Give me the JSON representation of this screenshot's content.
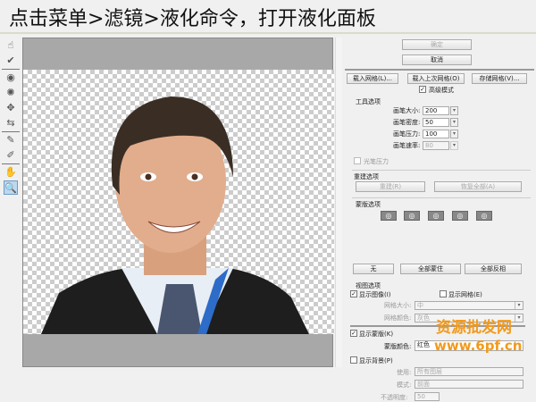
{
  "title": "点击菜单>滤镜>液化命令，打开液化面板",
  "tools": [
    "forward-warp",
    "reconstruct",
    "twirl",
    "pucker",
    "bloat",
    "push-left",
    "freeze-mask",
    "thaw-mask",
    "hand",
    "zoom"
  ],
  "panel": {
    "ok": "确定",
    "cancel": "取消",
    "load_mesh": "载入网格(L)...",
    "load_last_mesh": "载入上次网格(O)",
    "save_mesh": "存储网格(V)...",
    "advanced_mode": "高级模式",
    "advanced_checked": true,
    "tool_options": "工具选项",
    "brush_size_label": "画笔大小:",
    "brush_size": "200",
    "brush_density_label": "画笔密度:",
    "brush_density": "50",
    "brush_pressure_label": "画笔压力:",
    "brush_pressure": "100",
    "brush_rate_label": "画笔速率:",
    "brush_rate": "80",
    "stylus_pressure": "光笔压力",
    "reconstruct_options": "重建选项",
    "reconstruct": "重建(R)",
    "restore_all": "恢复全部(A)",
    "mask_options": "蒙版选项",
    "none": "无",
    "mask_all": "全部蒙住",
    "invert_all": "全部反相",
    "view_options": "视图选项",
    "show_image": "显示图像(I)",
    "show_image_checked": true,
    "show_mesh": "显示网格(E)",
    "show_mesh_checked": false,
    "mesh_size_label": "网格大小:",
    "mesh_size": "中",
    "mesh_color_label": "网格颜色:",
    "mesh_color": "灰色",
    "show_mask": "显示蒙版(K)",
    "show_mask_checked": true,
    "mask_color_label": "蒙版颜色:",
    "mask_color": "红色",
    "show_backdrop": "显示背景(P)",
    "show_backdrop_checked": false,
    "use_label": "使用:",
    "use": "所有图层",
    "mode_label": "模式:",
    "mode": "前面",
    "opacity_label": "不透明度:",
    "opacity": "50"
  },
  "watermark": {
    "line1": "资源批发网",
    "line2": "www.6pf.cn",
    "color": "#f29a1c"
  }
}
